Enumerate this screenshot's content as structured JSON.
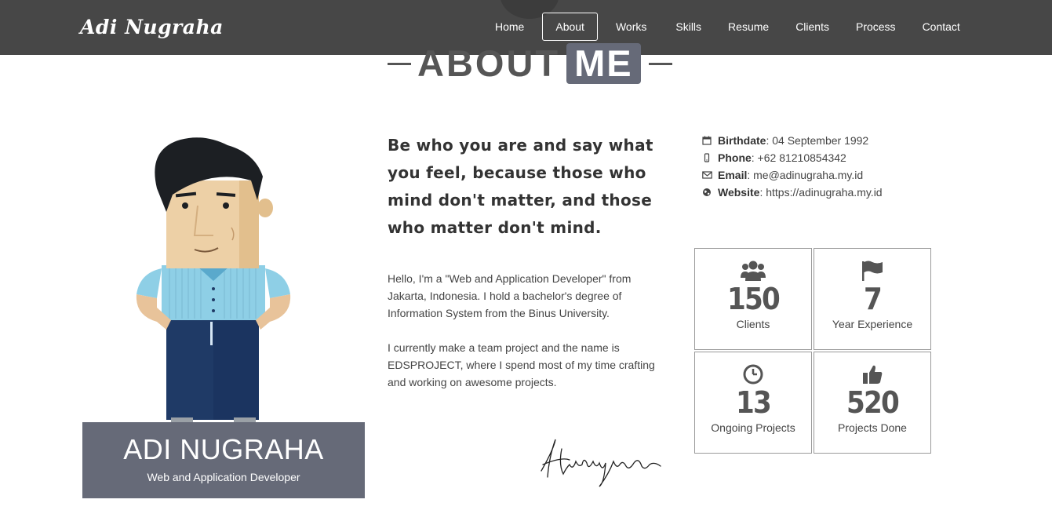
{
  "brand": "Adi Nugraha",
  "nav": {
    "home": "Home",
    "about": "About",
    "works": "Works",
    "skills": "Skills",
    "resume": "Resume",
    "clients": "Clients",
    "process": "Process",
    "contact": "Contact"
  },
  "heading": {
    "word": "ABOUT",
    "highlight": "ME"
  },
  "profile": {
    "name": "ADI NUGRAHA",
    "role": "Web and Application Developer"
  },
  "quote": "Be who you are and say what you feel, because those who mind don't matter, and those who matter don't mind.",
  "bio": [
    "Hello, I'm a \"Web and Application Developer\" from Jakarta, Indonesia. I hold a bachelor's degree of Information System from the Binus University.",
    "I currently make a team project and the name is EDSPROJECT, where I spend most of my time crafting and working on awesome projects."
  ],
  "info": {
    "birthdate_label": "Birthdate",
    "birthdate": " : 04 September 1992",
    "phone_label": "Phone",
    "phone": " : +62 81210854342",
    "email_label": "Email",
    "email": " : me@adinugraha.my.id",
    "website_label": "Website",
    "website": " : https://adinugraha.my.id"
  },
  "stats": [
    {
      "icon": "users-icon",
      "value": "150",
      "label": "Clients"
    },
    {
      "icon": "flag-icon",
      "value": "7",
      "label": "Year Experience"
    },
    {
      "icon": "clock-icon",
      "value": "13",
      "label": "Ongoing Projects"
    },
    {
      "icon": "thumbs-up-icon",
      "value": "520",
      "label": "Projects Done"
    }
  ],
  "colors": {
    "navbar": "#474747",
    "accent": "#666a78",
    "text": "#444444"
  }
}
